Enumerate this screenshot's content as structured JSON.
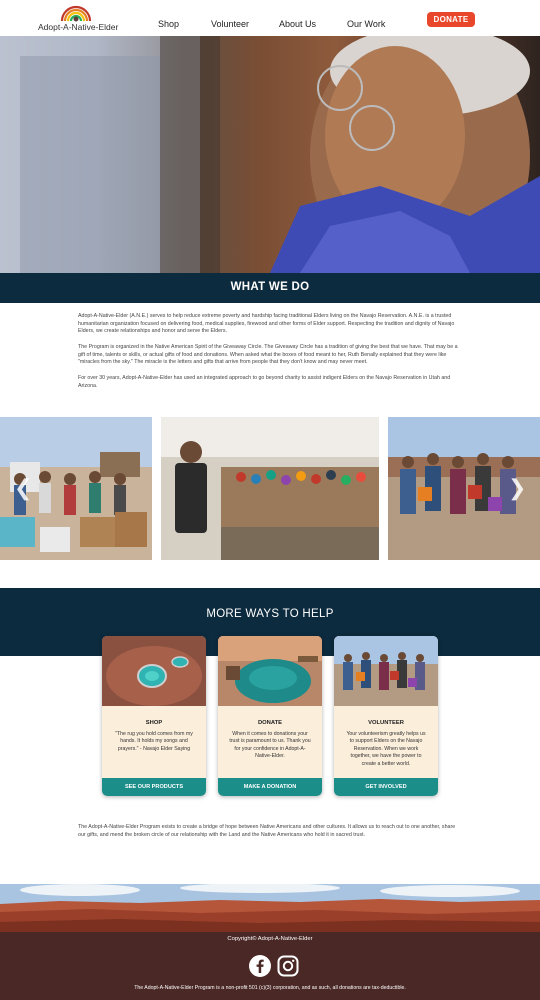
{
  "header": {
    "logo_text": "Adopt-A-Native-Elder",
    "nav": [
      "Shop",
      "Volunteer",
      "About Us",
      "Our Work"
    ],
    "donate_label": "DONATE"
  },
  "what_we_do": {
    "title": "WHAT WE DO",
    "paragraphs": [
      "Adopt-A-Native-Elder (A.N.E.) serves to help reduce extreme poverty and hardship facing traditional Elders living on the Navajo Reservation. A.N.E. is a trusted humanitarian organization focused on delivering food, medical supplies, firewood and other forms of Elder support. Respecting the tradition and dignity of Navajo Elders, we create relationships and honor and serve the Elders.",
      "The Program is organized in the Native American Spirit of the Giveaway Circle. The Giveaway Circle has a tradition of giving the best that we have. That may be a gift of time, talents or skills, or actual gifts of food and donations. When asked what the boxes of food meant to her, Ruth Benally explained that they were like \"miracles from the sky.\" The miracle is the letters and gifts that arrive from people that they don't know and may never meet.",
      "For over 30 years, Adopt-A-Native-Elder has used an integrated approach to go beyond charity to assist indigent Elders on the Navajo Reservation in Utah and Arizona."
    ]
  },
  "more_ways": {
    "title": "MORE WAYS TO HELP",
    "cards": [
      {
        "title": "SHOP",
        "text": "\"The rug you hold comes from my hands. It holds my songs and prayers.\" - Navajo Elder Saying",
        "button": "SEE OUR PRODUCTS"
      },
      {
        "title": "DONATE",
        "text": "When it comes to donations your trust is paramount to us. Thank you for your confidence in Adopt-A-Native-Elder.",
        "button": "MAKE A DONATION"
      },
      {
        "title": "VOLUNTEER",
        "text": "Your volunteerism greatly helps us to support Elders on the Navajo Reservation. When we work together, we have the power to create a better world.",
        "button": "GET INVOLVED"
      }
    ]
  },
  "closing_text": "The Adopt-A-Native-Elder Program exists to create a bridge of hope between Native Americans and other cultures. It allows us to reach out to one another, share our gifts, and mend the broken circle of our relationship with the Land and the Native Americans who hold it in sacred trust.",
  "footer": {
    "copyright": "Copyright© Adopt-A-Native-Elder",
    "social_icons": [
      "facebook-icon",
      "instagram-icon"
    ],
    "disclaimer": "The Adopt-A-Native-Elder Program is a non-profit 501 (c)(3) corporation, and as such, all donations are tax-deductible."
  },
  "colors": {
    "navy_band": "#0d2b3e",
    "donate_red": "#e8472b",
    "button_teal": "#1b8e8a",
    "card_cream": "#fbeedb",
    "footer_brown": "#4a2826"
  }
}
